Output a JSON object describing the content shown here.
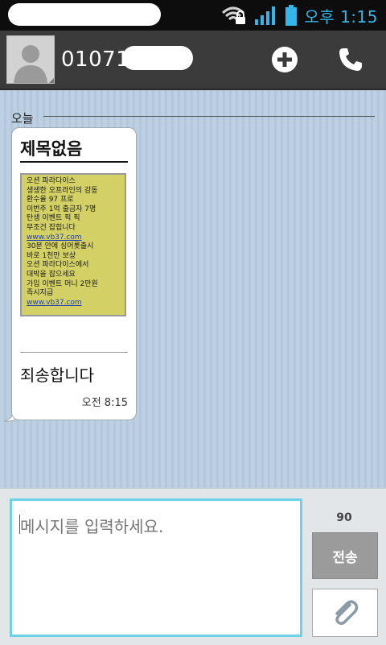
{
  "status_bar": {
    "time": "오후 1:15"
  },
  "header": {
    "contact_number": "01071"
  },
  "conversation": {
    "date_label": "오늘",
    "message": {
      "subject": "제목없음",
      "image_text": [
        "오션 파라다이스",
        "생생한 오프라인의 감동",
        "환수율 97 프로",
        "이번주 1억 출금자  7명",
        "탄생 이벤트 픽 픽",
        "무조건 잡힙니다",
        "www.vb37.com",
        "30분 안에 싱어롯출시",
        "바로  1천만 보상",
        "오션 파라다이스에서",
        "대박을 잡으세요",
        "가입 이벤트 머니 2만원",
        "즉시지급",
        "www.vb37.com"
      ],
      "body": "죄송합니다",
      "time": "오전 8:15"
    }
  },
  "composer": {
    "placeholder": "메시지를 입력하세요.",
    "char_count": "90",
    "send_label": "전송"
  }
}
